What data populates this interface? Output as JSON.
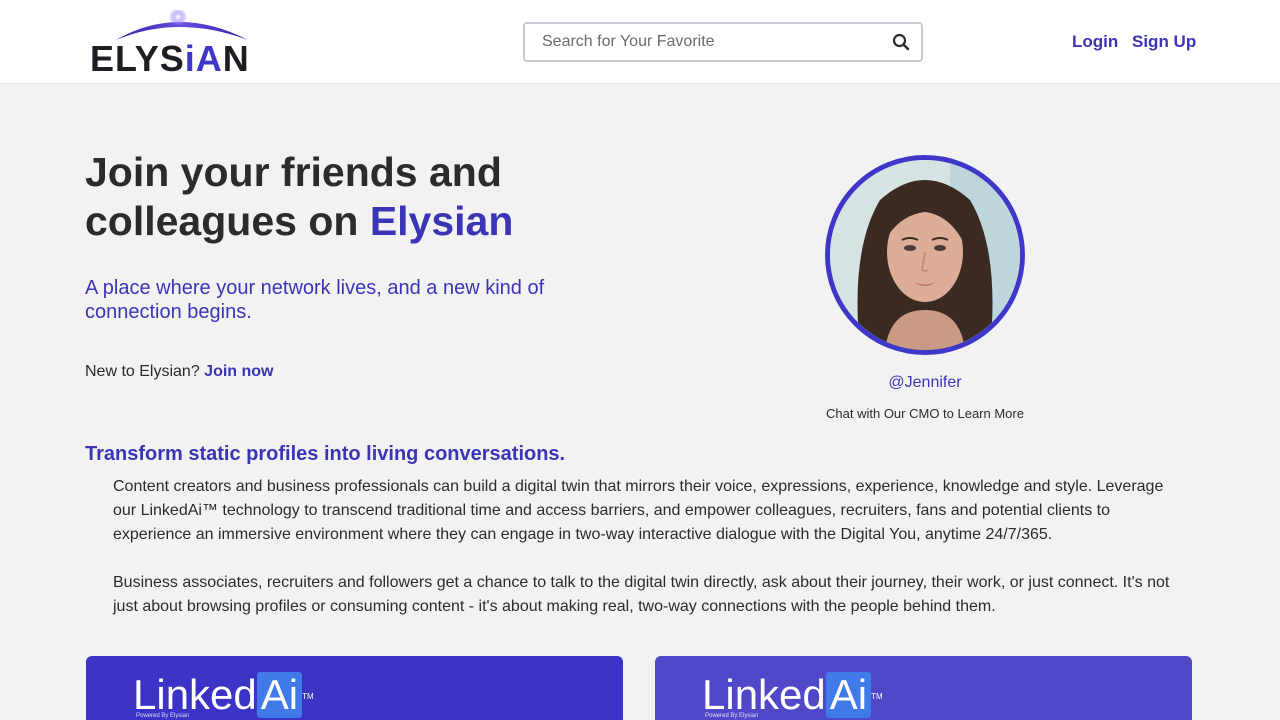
{
  "header": {
    "logo_text_pre": "ELYS",
    "logo_text_ia": "iA",
    "logo_text_post": "N",
    "search_placeholder": "Search for Your Favorite",
    "search_icon": "search-icon",
    "login_label": "Login",
    "signup_label": "Sign Up"
  },
  "hero": {
    "title_line1": "Join your friends and",
    "title_line2_pre": "colleagues on ",
    "title_brand": "Elysian",
    "subtitle": "A place where your network lives, and a new kind of connection begins.",
    "join_prompt": "New to Elysian? ",
    "join_link": "Join now"
  },
  "profile": {
    "handle": "@Jennifer",
    "caption": "Chat with Our CMO to Learn More"
  },
  "section": {
    "title": "Transform static profiles into living conversations.",
    "paragraph1": "Content creators and business professionals can build a digital twin that mirrors their voice, expressions, experience, knowledge and style. Leverage our LinkedAi™ technology to transcend traditional time and access barriers, and empower colleagues, recruiters, fans and potential clients to experience an immersive environment where they can engage in two-way interactive dialogue with the Digital You, anytime 24/7/365.",
    "paragraph2": "Business associates, recruiters and followers get a chance to talk to the digital twin directly, ask about their journey, their work, or just connect. It's not just about browsing profiles or consuming content - it's about making real, two-way connections with the people behind them."
  },
  "cards": [
    {
      "brand_pre": "Linked",
      "brand_ai": "Ai",
      "tm": "TM",
      "powered": "Powered By Elysian",
      "color": "#3a33c6"
    },
    {
      "brand_pre": "Linked",
      "brand_ai": "Ai",
      "tm": "TM",
      "powered": "Powered By Elysian",
      "color": "#5147c9"
    }
  ],
  "colors": {
    "accent": "#3a35b4",
    "background": "#f3f2f3",
    "header_bg": "#ffffff"
  }
}
